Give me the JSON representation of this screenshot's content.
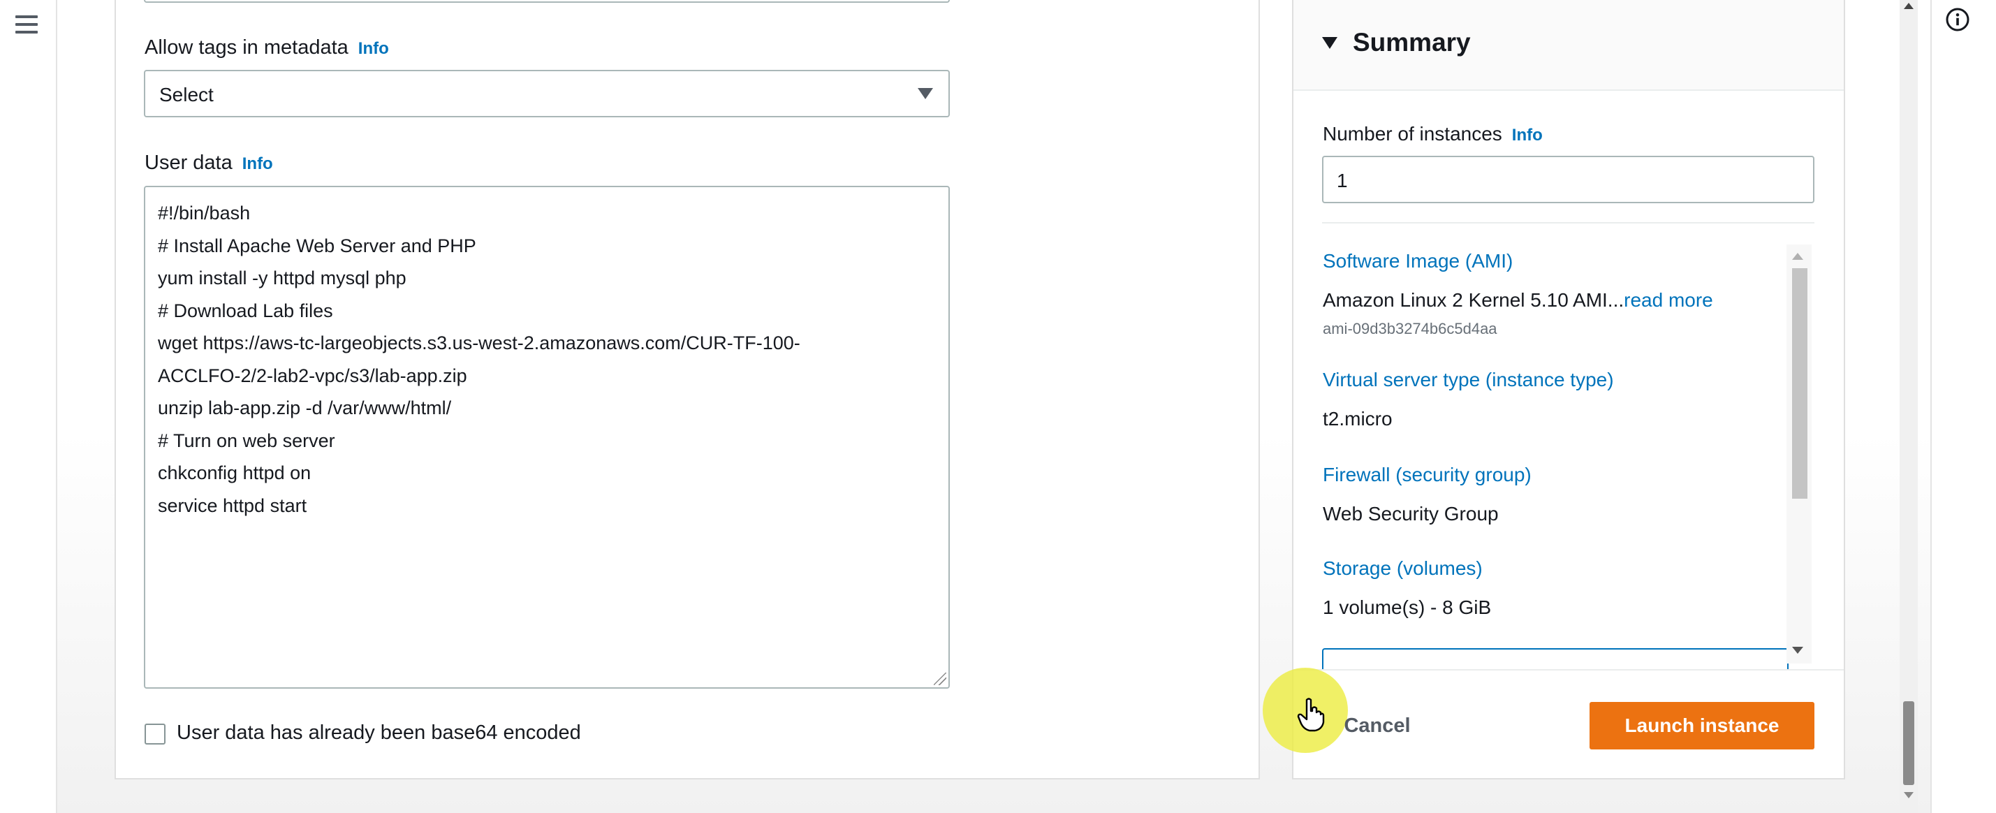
{
  "advanced_details": {
    "allow_tags": {
      "label": "Allow tags in metadata",
      "info": "Info",
      "value": "Select"
    },
    "user_data": {
      "label": "User data",
      "info": "Info",
      "lines": [
        "#!/bin/bash",
        "# Install Apache Web Server and PHP",
        "yum install -y httpd mysql php",
        "# Download Lab files",
        "wget https://aws-tc-largeobjects.s3.us-west-2.amazonaws.com/CUR-TF-100-",
        "ACCLFO-2/2-lab2-vpc/s3/lab-app.zip",
        "unzip lab-app.zip -d /var/www/html/",
        "# Turn on web server",
        "chkconfig httpd on",
        "service httpd start"
      ]
    },
    "base64_checkbox": {
      "label": "User data has already been base64 encoded",
      "checked": false
    }
  },
  "summary": {
    "title": "Summary",
    "number_of_instances": {
      "label": "Number of instances",
      "info": "Info",
      "value": "1"
    },
    "software_image": {
      "label": "Software Image (AMI)",
      "value": "Amazon Linux 2 Kernel 5.10 AMI...",
      "read_more": "read more",
      "ami_id": "ami-09d3b3274b6c5d4aa"
    },
    "instance_type": {
      "label": "Virtual server type (instance type)",
      "value": "t2.micro"
    },
    "firewall": {
      "label": "Firewall (security group)",
      "value": "Web Security Group"
    },
    "storage": {
      "label": "Storage (volumes)",
      "value": "1 volume(s) - 8 GiB"
    },
    "cancel_label": "Cancel",
    "launch_label": "Launch instance"
  },
  "colors": {
    "link": "#0073bb",
    "primary_button": "#ec7211",
    "cursor_highlight": "#ecec40"
  },
  "icons": {
    "menu": "hamburger-menu-icon",
    "info": "info-circle-icon",
    "cursor": "hand-pointer-icon"
  }
}
